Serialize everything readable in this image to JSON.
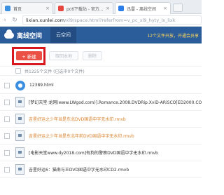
{
  "browser": {
    "tabs": [
      {
        "label": "首页",
        "active": false
      },
      {
        "label": "pc6下载站 - 官方...",
        "active": false
      },
      {
        "label": "迅雷 - 离线空间",
        "active": true
      }
    ],
    "url_host": "lixian.xunlei.com",
    "url_path": "/xl9/space.html?referfrom=v_pc_xl9_hyty_lx_lixk"
  },
  "header": {
    "brand": "离线空间",
    "tab": "云空间",
    "promo": "12个文件开放，开通会员享"
  },
  "toolbar": {
    "new_label": "+ 新建",
    "local_label": "取回本地",
    "delete_label": "删除"
  },
  "summary": "共1225个文件 (已选中0个文件)",
  "files": [
    {
      "name": "12389.html",
      "icon": "html-icon",
      "orange": false
    },
    {
      "name": "[梦幻天堂·龙网(www.LWgod.com)].Romance.2008.DVDRip.XviD-ARiSCO[ED2000.CO...",
      "icon": "video-file-icon",
      "orange": false
    },
    {
      "name": "吉星好运之少年当是东北DVD国语中字无水印.rmvb",
      "icon": "video-file-icon",
      "orange": true
    },
    {
      "name": "吉星好运之少年当是东北年前DVD国语中字无水印.rmvb",
      "icon": "video-file-icon",
      "orange": true
    },
    {
      "name": "[电影天堂www.dy2018.com]有狗的警察DVD国语中字无水印.rmvb",
      "icon": "video-file-icon",
      "orange": false
    },
    {
      "name": "吉星好运6：猫南与王DVD国语中字无水印CD2.rmvb",
      "icon": "video-file-icon",
      "orange": false
    }
  ]
}
